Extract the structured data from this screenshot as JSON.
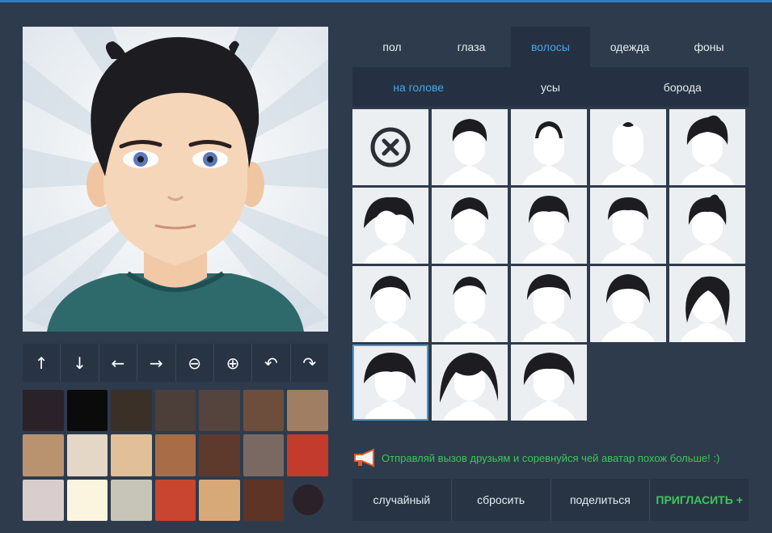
{
  "tabs": [
    {
      "label": "пол"
    },
    {
      "label": "глаза"
    },
    {
      "label": "волосы"
    },
    {
      "label": "одежда"
    },
    {
      "label": "фоны"
    }
  ],
  "active_tab": "волосы",
  "subtabs": [
    {
      "label": "на голове"
    },
    {
      "label": "усы"
    },
    {
      "label": "борода"
    }
  ],
  "active_subtab": "на голове",
  "toolbar": [
    {
      "icon": "arrow-up-icon",
      "glyph": "↑"
    },
    {
      "icon": "arrow-down-icon",
      "glyph": "↓"
    },
    {
      "icon": "arrow-left-icon",
      "glyph": "←"
    },
    {
      "icon": "arrow-right-icon",
      "glyph": "→"
    },
    {
      "icon": "zoom-out-icon",
      "glyph": "⊖"
    },
    {
      "icon": "zoom-in-icon",
      "glyph": "⊕"
    },
    {
      "icon": "undo-icon",
      "glyph": "↶"
    },
    {
      "icon": "redo-icon",
      "glyph": "↷"
    }
  ],
  "palette": [
    "#2a2228",
    "#0b0b0b",
    "#3a3028",
    "#4c3e38",
    "#55443d",
    "#6d4e3d",
    "#a07e63",
    "#b9936f",
    "#e4d7c6",
    "#e1bf99",
    "#a86d46",
    "#5e3a2c",
    "#7a6963",
    "#c33b2d",
    "#dacdcd",
    "#fbf5e0",
    "#c7c4b8",
    "#c9452f",
    "#d8a978",
    "#5d3426",
    "#2a2228"
  ],
  "hair_styles_count": 18,
  "selected_hair_index": 15,
  "invite_text": "Отправляй вызов друзьям и соревнуйся чей аватар похож больше! :)",
  "actions": [
    {
      "label": "случайный"
    },
    {
      "label": "сбросить"
    },
    {
      "label": "поделиться"
    },
    {
      "label": "ПРИГЛАСИТЬ +"
    }
  ],
  "colors": {
    "background": "#2e3b4c",
    "accent_blue": "#47a6e6",
    "accent_green": "#3cc75a",
    "hair": "#1d1d21"
  }
}
